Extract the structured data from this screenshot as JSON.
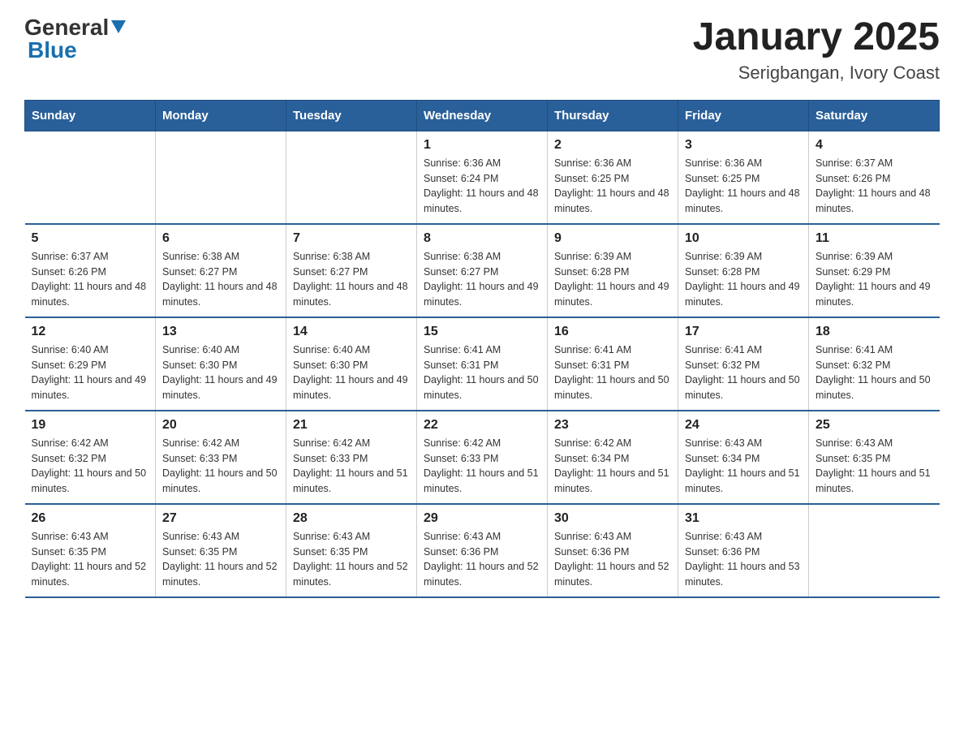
{
  "logo": {
    "text_general": "General",
    "text_blue": "Blue"
  },
  "title": "January 2025",
  "subtitle": "Serigbangan, Ivory Coast",
  "weekdays": [
    "Sunday",
    "Monday",
    "Tuesday",
    "Wednesday",
    "Thursday",
    "Friday",
    "Saturday"
  ],
  "weeks": [
    [
      {
        "day": "",
        "info": ""
      },
      {
        "day": "",
        "info": ""
      },
      {
        "day": "",
        "info": ""
      },
      {
        "day": "1",
        "info": "Sunrise: 6:36 AM\nSunset: 6:24 PM\nDaylight: 11 hours and 48 minutes."
      },
      {
        "day": "2",
        "info": "Sunrise: 6:36 AM\nSunset: 6:25 PM\nDaylight: 11 hours and 48 minutes."
      },
      {
        "day": "3",
        "info": "Sunrise: 6:36 AM\nSunset: 6:25 PM\nDaylight: 11 hours and 48 minutes."
      },
      {
        "day": "4",
        "info": "Sunrise: 6:37 AM\nSunset: 6:26 PM\nDaylight: 11 hours and 48 minutes."
      }
    ],
    [
      {
        "day": "5",
        "info": "Sunrise: 6:37 AM\nSunset: 6:26 PM\nDaylight: 11 hours and 48 minutes."
      },
      {
        "day": "6",
        "info": "Sunrise: 6:38 AM\nSunset: 6:27 PM\nDaylight: 11 hours and 48 minutes."
      },
      {
        "day": "7",
        "info": "Sunrise: 6:38 AM\nSunset: 6:27 PM\nDaylight: 11 hours and 48 minutes."
      },
      {
        "day": "8",
        "info": "Sunrise: 6:38 AM\nSunset: 6:27 PM\nDaylight: 11 hours and 49 minutes."
      },
      {
        "day": "9",
        "info": "Sunrise: 6:39 AM\nSunset: 6:28 PM\nDaylight: 11 hours and 49 minutes."
      },
      {
        "day": "10",
        "info": "Sunrise: 6:39 AM\nSunset: 6:28 PM\nDaylight: 11 hours and 49 minutes."
      },
      {
        "day": "11",
        "info": "Sunrise: 6:39 AM\nSunset: 6:29 PM\nDaylight: 11 hours and 49 minutes."
      }
    ],
    [
      {
        "day": "12",
        "info": "Sunrise: 6:40 AM\nSunset: 6:29 PM\nDaylight: 11 hours and 49 minutes."
      },
      {
        "day": "13",
        "info": "Sunrise: 6:40 AM\nSunset: 6:30 PM\nDaylight: 11 hours and 49 minutes."
      },
      {
        "day": "14",
        "info": "Sunrise: 6:40 AM\nSunset: 6:30 PM\nDaylight: 11 hours and 49 minutes."
      },
      {
        "day": "15",
        "info": "Sunrise: 6:41 AM\nSunset: 6:31 PM\nDaylight: 11 hours and 50 minutes."
      },
      {
        "day": "16",
        "info": "Sunrise: 6:41 AM\nSunset: 6:31 PM\nDaylight: 11 hours and 50 minutes."
      },
      {
        "day": "17",
        "info": "Sunrise: 6:41 AM\nSunset: 6:32 PM\nDaylight: 11 hours and 50 minutes."
      },
      {
        "day": "18",
        "info": "Sunrise: 6:41 AM\nSunset: 6:32 PM\nDaylight: 11 hours and 50 minutes."
      }
    ],
    [
      {
        "day": "19",
        "info": "Sunrise: 6:42 AM\nSunset: 6:32 PM\nDaylight: 11 hours and 50 minutes."
      },
      {
        "day": "20",
        "info": "Sunrise: 6:42 AM\nSunset: 6:33 PM\nDaylight: 11 hours and 50 minutes."
      },
      {
        "day": "21",
        "info": "Sunrise: 6:42 AM\nSunset: 6:33 PM\nDaylight: 11 hours and 51 minutes."
      },
      {
        "day": "22",
        "info": "Sunrise: 6:42 AM\nSunset: 6:33 PM\nDaylight: 11 hours and 51 minutes."
      },
      {
        "day": "23",
        "info": "Sunrise: 6:42 AM\nSunset: 6:34 PM\nDaylight: 11 hours and 51 minutes."
      },
      {
        "day": "24",
        "info": "Sunrise: 6:43 AM\nSunset: 6:34 PM\nDaylight: 11 hours and 51 minutes."
      },
      {
        "day": "25",
        "info": "Sunrise: 6:43 AM\nSunset: 6:35 PM\nDaylight: 11 hours and 51 minutes."
      }
    ],
    [
      {
        "day": "26",
        "info": "Sunrise: 6:43 AM\nSunset: 6:35 PM\nDaylight: 11 hours and 52 minutes."
      },
      {
        "day": "27",
        "info": "Sunrise: 6:43 AM\nSunset: 6:35 PM\nDaylight: 11 hours and 52 minutes."
      },
      {
        "day": "28",
        "info": "Sunrise: 6:43 AM\nSunset: 6:35 PM\nDaylight: 11 hours and 52 minutes."
      },
      {
        "day": "29",
        "info": "Sunrise: 6:43 AM\nSunset: 6:36 PM\nDaylight: 11 hours and 52 minutes."
      },
      {
        "day": "30",
        "info": "Sunrise: 6:43 AM\nSunset: 6:36 PM\nDaylight: 11 hours and 52 minutes."
      },
      {
        "day": "31",
        "info": "Sunrise: 6:43 AM\nSunset: 6:36 PM\nDaylight: 11 hours and 53 minutes."
      },
      {
        "day": "",
        "info": ""
      }
    ]
  ]
}
